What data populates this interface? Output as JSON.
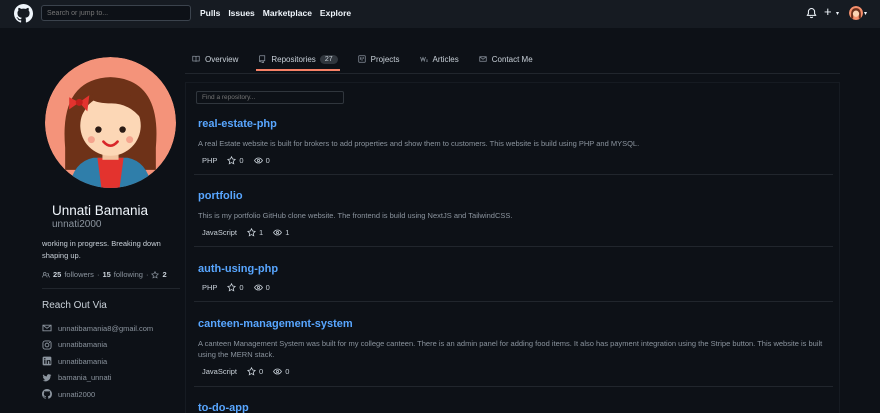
{
  "header": {
    "search_placeholder": "Search or jump to...",
    "nav": [
      "Pulls",
      "Issues",
      "Marketplace",
      "Explore"
    ],
    "plus": "+",
    "caret": "▾"
  },
  "profile": {
    "name": "Unnati Bamania",
    "login": "unnati2000",
    "bio": "working in progress. Breaking down shaping up.",
    "followers_count": "25",
    "followers_label": "followers",
    "following_count": "15",
    "following_label": "following",
    "separator": "·",
    "stars": "2",
    "reach_title": "Reach Out Via",
    "contacts": [
      {
        "icon": "mail-icon",
        "text": "unnatibamania8@gmail.com"
      },
      {
        "icon": "instagram-icon",
        "text": "unnatibamania"
      },
      {
        "icon": "linkedin-icon",
        "text": "unnatibamania"
      },
      {
        "icon": "twitter-icon",
        "text": "bamania_unnati"
      },
      {
        "icon": "github-icon",
        "text": "unnati2000"
      }
    ]
  },
  "tabs": [
    {
      "label": "Overview",
      "icon": "book-icon"
    },
    {
      "label": "Repositories",
      "icon": "repo-icon",
      "count": "27",
      "active": true
    },
    {
      "label": "Projects",
      "icon": "project-icon"
    },
    {
      "label": "Articles",
      "icon": "articles-icon"
    },
    {
      "label": "Contact Me",
      "icon": "mail-icon"
    }
  ],
  "find_placeholder": "Find a repository...",
  "repos": [
    {
      "name": "real-estate-php",
      "description": "A real Estate website is built for brokers to add properties and show them to customers. This website is build using PHP and MYSQL.",
      "language": "PHP",
      "stars": "0",
      "watchers": "0"
    },
    {
      "name": "portfolio",
      "description": "This is my portfolio GitHub clone website. The frontend is build using NextJS and TailwindCSS.",
      "language": "JavaScript",
      "stars": "1",
      "watchers": "1"
    },
    {
      "name": "auth-using-php",
      "description": "",
      "language": "PHP",
      "stars": "0",
      "watchers": "0"
    },
    {
      "name": "canteen-management-system",
      "description": "A canteen Management System was built for my college canteen. There is an admin panel for adding food items. It also has payment integration using the Stripe button. This website is built using the MERN stack.",
      "language": "JavaScript",
      "stars": "0",
      "watchers": "0"
    },
    {
      "name": "to-do-app",
      "description": "",
      "language": "",
      "stars": "",
      "watchers": ""
    }
  ],
  "colors": {
    "accent": "#58a6ff",
    "tab_underline": "#f78166",
    "background": "#0d1117"
  }
}
